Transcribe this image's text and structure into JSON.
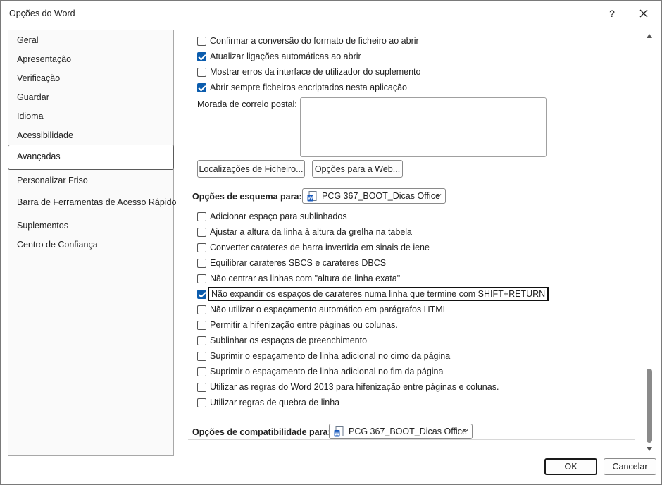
{
  "window": {
    "title": "Opções do Word",
    "help_label": "?",
    "close_icon": "close-icon"
  },
  "sidebar": {
    "items": [
      {
        "label": "Geral"
      },
      {
        "label": "Apresentação"
      },
      {
        "label": "Verificação"
      },
      {
        "label": "Guardar"
      },
      {
        "label": "Idioma"
      },
      {
        "label": "Acessibilidade"
      },
      {
        "label": "Avançadas",
        "selected": true
      },
      {
        "label": "Personalizar Friso"
      },
      {
        "label": "Barra de Ferramentas de Acesso Rápido"
      },
      {
        "label": "Suplementos"
      },
      {
        "label": "Centro de Confiança"
      }
    ]
  },
  "general": {
    "options": [
      {
        "label": "Confirmar a conversão do formato de ficheiro ao abrir",
        "checked": false
      },
      {
        "label": "Atualizar ligações automáticas ao abrir",
        "checked": true
      },
      {
        "label": "Mostrar erros da interface de utilizador do suplemento",
        "checked": false
      },
      {
        "label": "Abrir sempre ficheiros encriptados nesta aplicação",
        "checked": true
      }
    ],
    "postal_label": "Morada de correio postal:",
    "postal_value": "",
    "file_locations_button": "Localizações de Ficheiro...",
    "web_options_button": "Opções para a Web..."
  },
  "layout_options": {
    "heading": "Opções de esquema para:",
    "document": "PCG 367_BOOT_Dicas Office",
    "options": [
      {
        "label": "Adicionar espaço para sublinhados",
        "checked": false
      },
      {
        "label": "Ajustar a altura da linha à altura da grelha na tabela",
        "checked": false
      },
      {
        "label": "Converter carateres de barra invertida em sinais de iene",
        "checked": false
      },
      {
        "label": "Equilibrar carateres SBCS e carateres DBCS",
        "checked": false
      },
      {
        "label": "Não centrar as linhas com \"altura de linha exata\"",
        "checked": false
      },
      {
        "label": "Não expandir os espaços de carateres numa linha que termine com SHIFT+RETURN",
        "checked": true,
        "focused": true
      },
      {
        "label": "Não utilizar o espaçamento automático em parágrafos HTML",
        "checked": false
      },
      {
        "label": "Permitir a hifenização entre páginas ou colunas.",
        "checked": false
      },
      {
        "label": "Sublinhar os espaços de preenchimento",
        "checked": false
      },
      {
        "label": "Suprimir o espaçamento de linha adicional no cimo da página",
        "checked": false
      },
      {
        "label": "Suprimir o espaçamento de linha adicional no fim da página",
        "checked": false
      },
      {
        "label": "Utilizar as regras do Word 2013 para hifenização entre páginas e colunas.",
        "checked": false
      },
      {
        "label": "Utilizar regras de quebra de linha",
        "checked": false
      }
    ]
  },
  "compat_options": {
    "heading": "Opções de compatibilidade para:",
    "document": "PCG 367_BOOT_Dicas Office"
  },
  "footer": {
    "ok_label": "OK",
    "cancel_label": "Cancelar"
  },
  "colors": {
    "accent": "#0b5cad",
    "word_icon": "#185abd"
  }
}
